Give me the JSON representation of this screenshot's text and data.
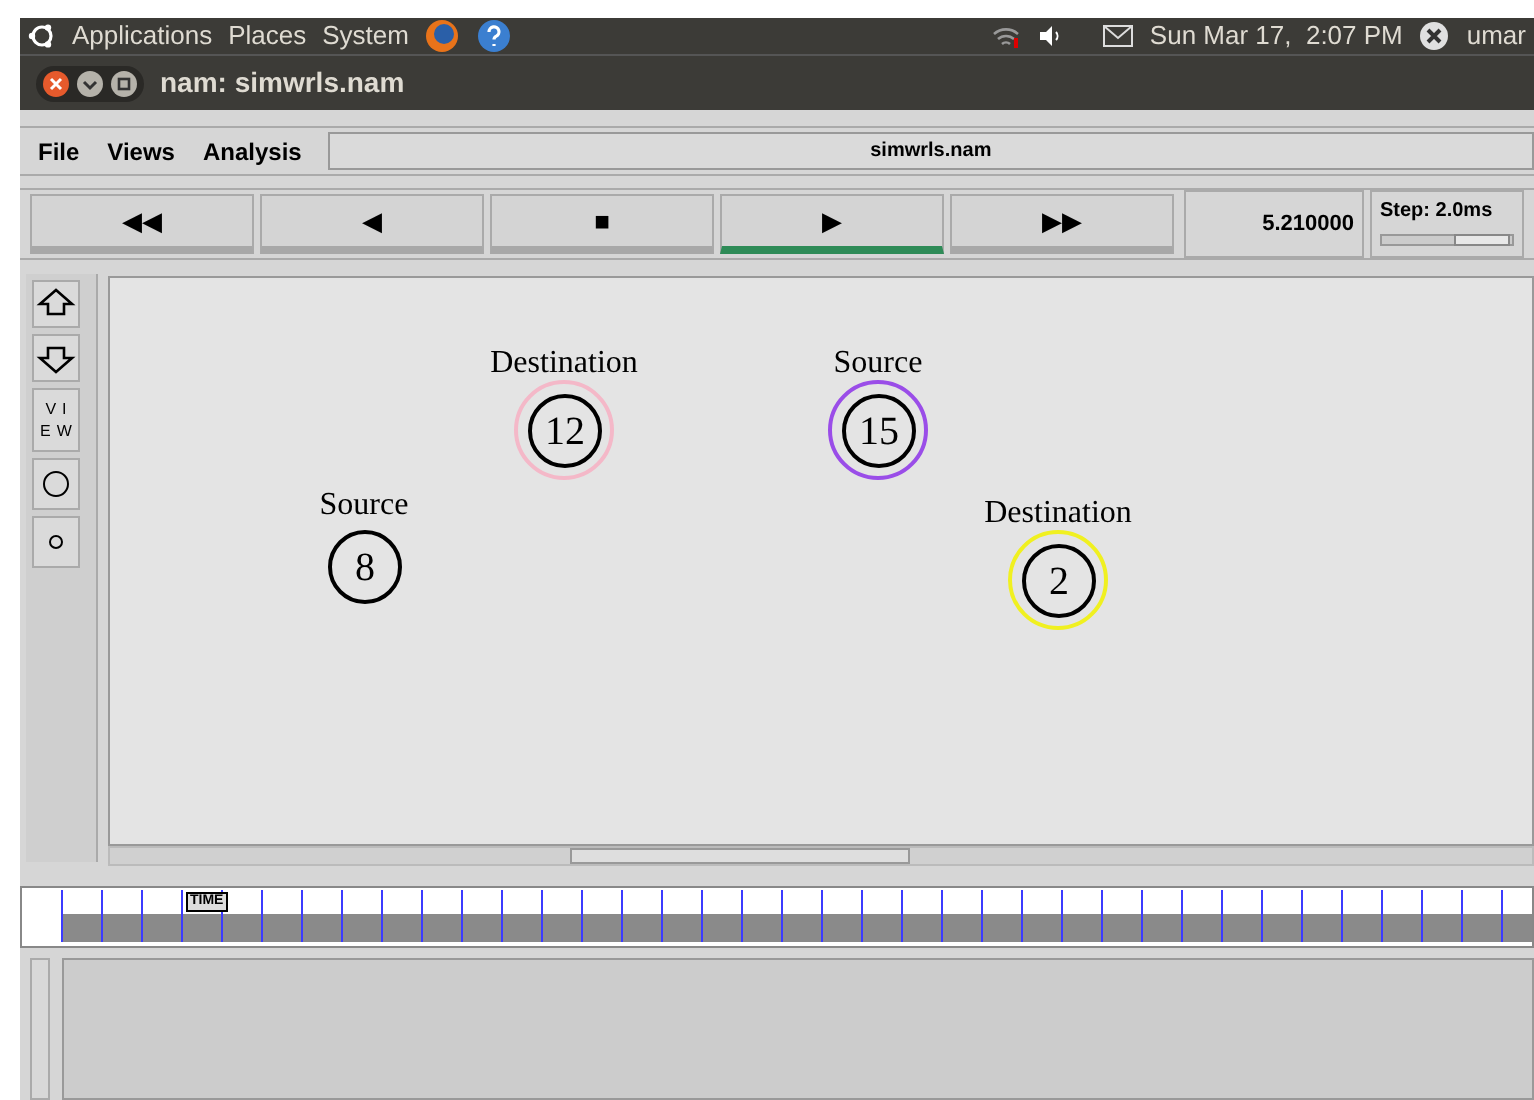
{
  "top_panel": {
    "menus": [
      "Applications",
      "Places",
      "System"
    ],
    "clock": "Sun Mar 17,  2:07 PM",
    "user": "umar"
  },
  "window": {
    "title": "nam: simwrls.nam"
  },
  "menu_bar": {
    "items": [
      "File",
      "Views",
      "Analysis"
    ],
    "file_name": "simwrls.nam"
  },
  "transport": {
    "buttons": [
      {
        "label": "◀◀",
        "selected": false
      },
      {
        "label": "◀",
        "selected": false
      },
      {
        "label": "■",
        "selected": false
      },
      {
        "label": "▶",
        "selected": true
      },
      {
        "label": "▶▶",
        "selected": false
      }
    ],
    "time": "5.210000",
    "step": "Step: 2.0ms"
  },
  "side_tools": [
    {
      "kind": "zoom-in"
    },
    {
      "kind": "zoom-out"
    },
    {
      "kind": "text",
      "label": "VIEW"
    },
    {
      "kind": "large-circle"
    },
    {
      "kind": "small-circle"
    }
  ],
  "nodes": [
    {
      "label": "Destination",
      "number": "12",
      "color": "#f4b8c8"
    },
    {
      "label": "Source",
      "number": "15",
      "color": "#9a4de8"
    },
    {
      "label": "Source",
      "number": "8"
    },
    {
      "label": "Destination",
      "number": "2",
      "color": "#f0f020"
    }
  ],
  "timeline": {
    "marker": "TIME"
  }
}
